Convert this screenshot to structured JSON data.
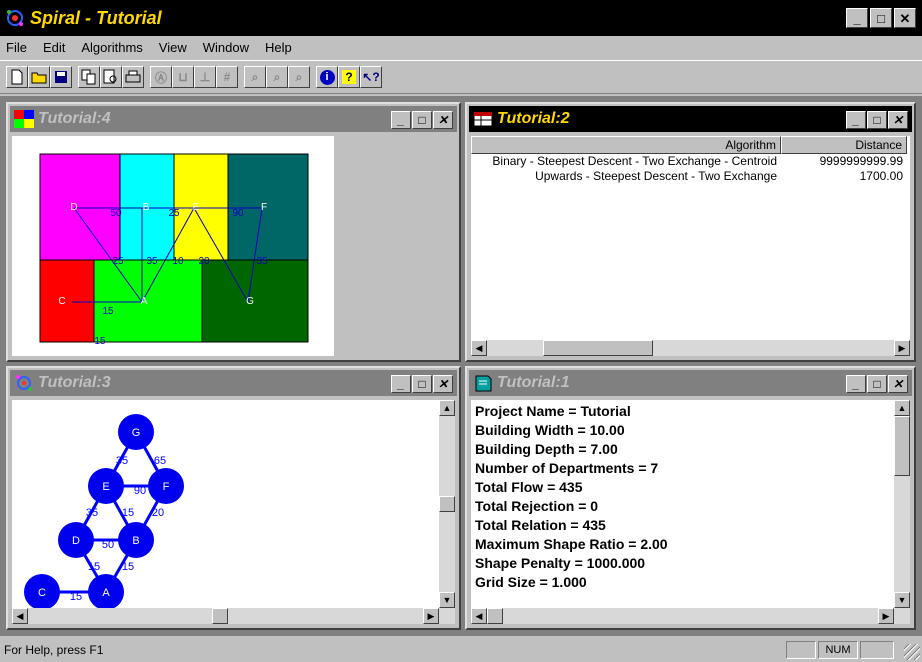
{
  "app": {
    "title": "Spiral - Tutorial"
  },
  "menu": [
    "File",
    "Edit",
    "Algorithms",
    "View",
    "Window",
    "Help"
  ],
  "toolbar": {
    "groups": [
      [
        "new-icon",
        "open-icon",
        "save-icon"
      ],
      [
        "copy-icon",
        "print-preview-icon",
        "print-icon"
      ],
      [
        "shape-a-icon",
        "shape-b-icon",
        "shape-c-icon",
        "grid-icon"
      ],
      [
        "zoom-icon",
        "zoom-in-icon",
        "zoom-out-icon"
      ],
      [
        "info-icon",
        "help-icon",
        "context-help-icon"
      ]
    ]
  },
  "windows": {
    "tut4": {
      "title": "Tutorial:4"
    },
    "tut2": {
      "title": "Tutorial:2"
    },
    "tut3": {
      "title": "Tutorial:3"
    },
    "tut1": {
      "title": "Tutorial:1"
    }
  },
  "layout_plan": {
    "departments": [
      {
        "label": "D",
        "color": "#ff00ff"
      },
      {
        "label": "B",
        "color": "#00ffff"
      },
      {
        "label": "E",
        "color": "#ffff00"
      },
      {
        "label": "F",
        "color": "#006666"
      },
      {
        "label": "C",
        "color": "#ff0000"
      },
      {
        "label": "A",
        "color": "#00ff00"
      },
      {
        "label": "G",
        "color": "#006600"
      }
    ],
    "flow_labels": [
      "50",
      "25",
      "90",
      "25",
      "35",
      "10",
      "15",
      "20",
      "35",
      "15"
    ]
  },
  "algorithms_table": {
    "headers": [
      "Algorithm",
      "Distance"
    ],
    "rows": [
      [
        "Binary - Steepest Descent - Two Exchange - Centroid",
        "9999999999.99"
      ],
      [
        "Upwards - Steepest Descent - Two Exchange",
        "1700.00"
      ]
    ]
  },
  "graph": {
    "nodes": [
      "G",
      "E",
      "F",
      "D",
      "B",
      "C",
      "A"
    ],
    "edge_labels": [
      "35",
      "65",
      "90",
      "35",
      "15",
      "20",
      "50",
      "15",
      "15",
      "15"
    ]
  },
  "project_info": [
    "Project Name = Tutorial",
    "Building Width = 10.00",
    "Building Depth = 7.00",
    "Number of Departments = 7",
    "Total Flow = 435",
    "Total Rejection = 0",
    "Total Relation = 435",
    "Maximum Shape Ratio = 2.00",
    "Shape Penalty = 1000.000",
    "Grid Size = 1.000"
  ],
  "status": {
    "help_text": "For Help, press F1",
    "num": "NUM"
  }
}
